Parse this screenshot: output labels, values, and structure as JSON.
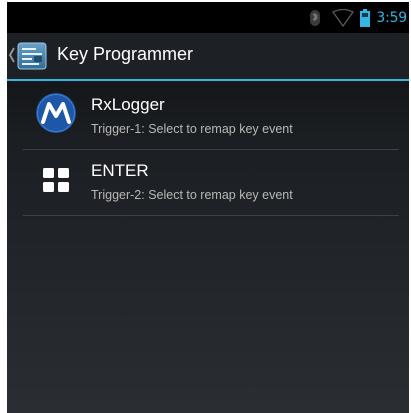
{
  "status_bar": {
    "time": "3:59",
    "icons": [
      "bluetooth-icon",
      "wifi-icon",
      "battery-icon"
    ],
    "accent_color": "#33b5e5"
  },
  "action_bar": {
    "title": "Key Programmer",
    "up_icon": "chevron-left-icon",
    "app_icon": "key-programmer-icon"
  },
  "list": {
    "items": [
      {
        "title": "RxLogger",
        "summary": "Trigger-1: Select to remap key event",
        "icon": "motorola-logo-icon"
      },
      {
        "title": "ENTER",
        "summary": "Trigger-2: Select to remap key event",
        "icon": "grid-icon"
      }
    ]
  }
}
